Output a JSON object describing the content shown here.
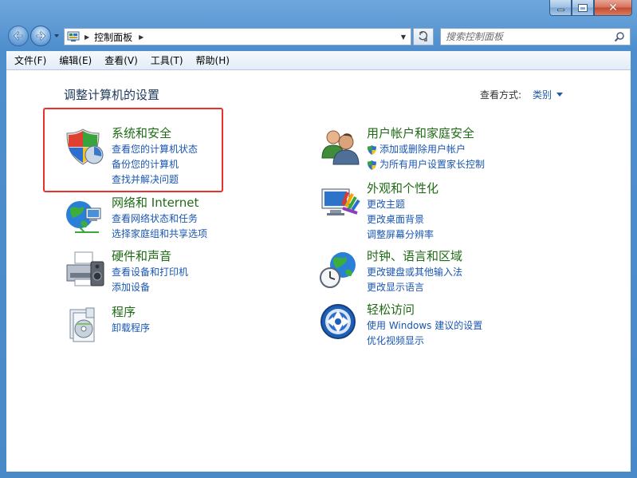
{
  "address": {
    "path": "控制面板"
  },
  "search": {
    "placeholder": "搜索控制面板"
  },
  "menubar": {
    "items": [
      "文件(F)",
      "编辑(E)",
      "查看(V)",
      "工具(T)",
      "帮助(H)"
    ]
  },
  "content": {
    "title": "调整计算机的设置",
    "view_by_label": "查看方式:",
    "view_by_value": "类别"
  },
  "categories": {
    "system": {
      "title": "系统和安全",
      "icon": "system-security-shield-icon",
      "links": [
        "查看您的计算机状态",
        "备份您的计算机",
        "查找并解决问题"
      ]
    },
    "user": {
      "title": "用户帐户和家庭安全",
      "icon": "user-accounts-icon",
      "links": [
        "添加或删除用户帐户",
        "为所有用户设置家长控制"
      ]
    },
    "network": {
      "title": "网络和 Internet",
      "icon": "network-globe-icon",
      "links": [
        "查看网络状态和任务",
        "选择家庭组和共享选项"
      ]
    },
    "appearance": {
      "title": "外观和个性化",
      "icon": "appearance-monitor-icon",
      "links": [
        "更改主题",
        "更改桌面背景",
        "调整屏幕分辨率"
      ]
    },
    "hardware": {
      "title": "硬件和声音",
      "icon": "printer-icon",
      "links": [
        "查看设备和打印机",
        "添加设备"
      ]
    },
    "clock": {
      "title": "时钟、语言和区域",
      "icon": "clock-globe-icon",
      "links": [
        "更改键盘或其他输入法",
        "更改显示语言"
      ]
    },
    "programs": {
      "title": "程序",
      "icon": "programs-icon",
      "links": [
        "卸载程序"
      ]
    },
    "access": {
      "title": "轻松访问",
      "icon": "ease-of-access-icon",
      "links": [
        "使用 Windows 建议的设置",
        "优化视频显示"
      ]
    }
  },
  "colors": {
    "category_title": "#1e6b14",
    "link": "#1a56b2",
    "highlight_border": "#e8312c"
  }
}
